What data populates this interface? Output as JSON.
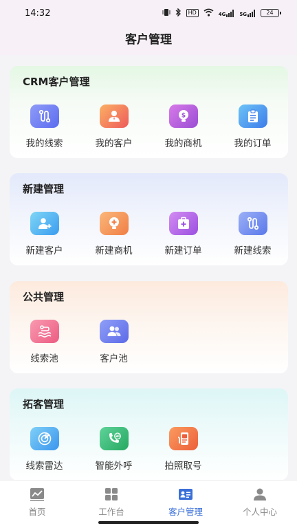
{
  "status_bar": {
    "time": "14:32",
    "icons": [
      "vibrate-icon",
      "bluetooth-icon",
      "hd-icon",
      "wifi-icon",
      "signal-4g-icon",
      "signal-5g-icon"
    ],
    "hd_label": "HD",
    "net1_label": "4G",
    "net2_label": "5G",
    "battery": "24"
  },
  "header": {
    "title": "客户管理"
  },
  "colors": {
    "accent": "#3a6fd8",
    "tab_inactive": "#8a8a8a"
  },
  "sections": [
    {
      "title": "CRM客户管理",
      "items": [
        {
          "label": "我的线索",
          "icon": "route-icon",
          "color": "#6b7ef2"
        },
        {
          "label": "我的客户",
          "icon": "person-icon",
          "color": "#f2795e"
        },
        {
          "label": "我的商机",
          "icon": "money-bulb-icon",
          "color": "#b35ad8"
        },
        {
          "label": "我的订单",
          "icon": "clipboard-icon",
          "color": "#4d96f0"
        }
      ]
    },
    {
      "title": "新建管理",
      "items": [
        {
          "label": "新建客户",
          "icon": "add-person-icon",
          "color": "#49b0f0"
        },
        {
          "label": "新建商机",
          "icon": "add-bulb-icon",
          "color": "#f5945a"
        },
        {
          "label": "新建订单",
          "icon": "add-bag-icon",
          "color": "#b461e6"
        },
        {
          "label": "新建线索",
          "icon": "route-icon",
          "color": "#6e8df2"
        }
      ]
    },
    {
      "title": "公共管理",
      "items": [
        {
          "label": "线索池",
          "icon": "pool-icon",
          "color": "#f0668a"
        },
        {
          "label": "客户池",
          "icon": "group-icon",
          "color": "#6c7cf0"
        }
      ]
    },
    {
      "title": "拓客管理",
      "items": [
        {
          "label": "线索雷达",
          "icon": "radar-icon",
          "color": "#4fb0f0"
        },
        {
          "label": "智能外呼",
          "icon": "phone-ai-icon",
          "color": "#3fbf7a"
        },
        {
          "label": "拍照取号",
          "icon": "photo-id-icon",
          "color": "#f07a45"
        }
      ]
    }
  ],
  "tabs": [
    {
      "label": "首页",
      "icon": "chart-icon",
      "active": false
    },
    {
      "label": "工作台",
      "icon": "grid-icon",
      "active": false
    },
    {
      "label": "客户管理",
      "icon": "contact-card-icon",
      "active": true
    },
    {
      "label": "个人中心",
      "icon": "user-icon",
      "active": false
    }
  ]
}
